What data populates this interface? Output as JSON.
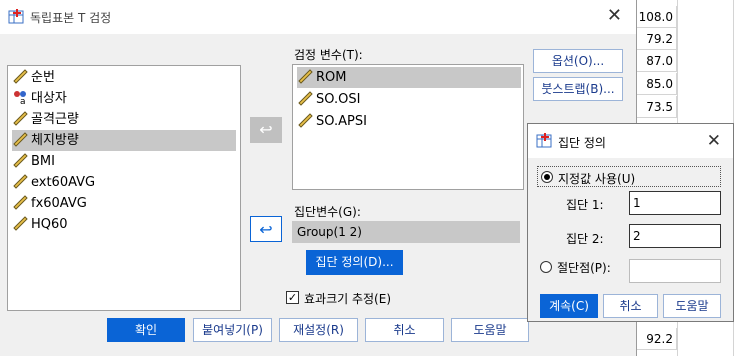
{
  "sheet": {
    "values": [
      "108.0",
      "79.2",
      "87.0",
      "85.0",
      "73.5",
      "92.2"
    ]
  },
  "dialog": {
    "title": "독립표본 T 검정",
    "variables": [
      {
        "label": "순번",
        "icon": "ruler-icon"
      },
      {
        "label": "대상자",
        "icon": "nominal-a-icon"
      },
      {
        "label": "골격근량",
        "icon": "ruler-icon"
      },
      {
        "label": "체지방량",
        "icon": "ruler-icon",
        "selected": true
      },
      {
        "label": "BMI",
        "icon": "ruler-icon"
      },
      {
        "label": "ext60AVG",
        "icon": "ruler-icon"
      },
      {
        "label": "fx60AVG",
        "icon": "ruler-icon"
      },
      {
        "label": "HQ60",
        "icon": "ruler-icon"
      }
    ],
    "test_vars_label": "검정 변수(T):",
    "test_vars": [
      {
        "label": "ROM",
        "selected": true
      },
      {
        "label": "SO.OSI"
      },
      {
        "label": "SO.APSI"
      }
    ],
    "grouping_label": "집단변수(G):",
    "grouping_value": "Group(1 2)",
    "define_groups_button": "집단 정의(D)...",
    "effect_size_label": "효과크기 추정(E)",
    "effect_size_checked": true,
    "options_button": "옵션(O)...",
    "bootstrap_button": "붓스트랩(B)...",
    "footer_buttons": {
      "ok": "확인",
      "paste": "붙여넣기(P)",
      "reset": "재설정(R)",
      "cancel": "취소",
      "help": "도움말"
    }
  },
  "define_groups": {
    "title": "집단 정의",
    "use_values_label": "지정값 사용(U)",
    "group1_label": "집단 1:",
    "group1_value": "1",
    "group2_label": "집단 2:",
    "group2_value": "2",
    "cut_point_label": "절단점(P):",
    "cut_point_value": "",
    "buttons": {
      "continue": "계속(C)",
      "cancel": "취소",
      "help": "도움말"
    }
  }
}
